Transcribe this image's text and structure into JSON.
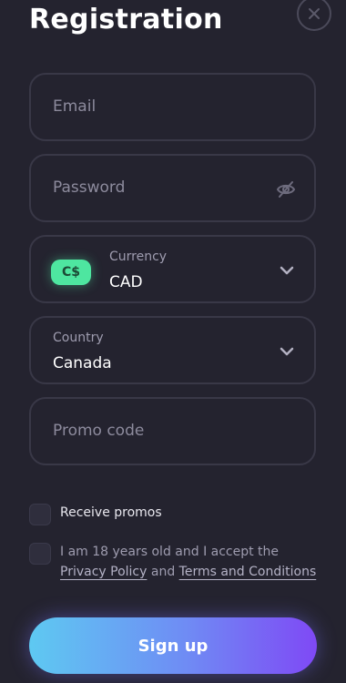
{
  "header": {
    "title": "Registration",
    "close_icon": "close-icon"
  },
  "form": {
    "email": {
      "placeholder": "Email",
      "value": ""
    },
    "password": {
      "placeholder": "Password",
      "value": "",
      "icon": "eye-off-icon"
    },
    "currency": {
      "label": "Currency",
      "value": "CAD",
      "badge": "C$",
      "badge_color": "#4ee6a0"
    },
    "country": {
      "label": "Country",
      "value": "Canada"
    },
    "promo": {
      "placeholder": "Promo code",
      "value": ""
    }
  },
  "checkboxes": {
    "promos": {
      "label": "Receive promos",
      "checked": false
    },
    "terms": {
      "text_before": "I am 18 years old and I accept the ",
      "privacy_link": "Privacy Policy",
      "text_middle": " and ",
      "terms_link": "Terms and Conditions",
      "checked": false
    }
  },
  "actions": {
    "signup_label": "Sign up",
    "accent_start": "#5ec9f2",
    "accent_end": "#7f49f5"
  }
}
